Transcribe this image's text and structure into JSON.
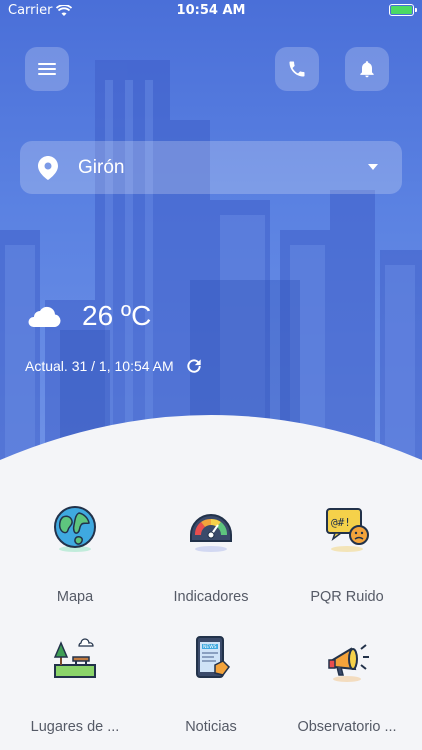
{
  "status_bar": {
    "carrier": "Carrier",
    "time": "10:54 AM"
  },
  "header": {
    "location": "Girón",
    "temperature": "26 ºC",
    "updated": "Actual. 31 / 1, 10:54 AM"
  },
  "menu": [
    {
      "label": "Mapa",
      "icon": "globe-icon"
    },
    {
      "label": "Indicadores",
      "icon": "gauge-icon"
    },
    {
      "label": "PQR Ruido",
      "icon": "noise-complaint-icon"
    },
    {
      "label": "Lugares de ...",
      "icon": "park-icon"
    },
    {
      "label": "Noticias",
      "icon": "news-icon"
    },
    {
      "label": "Observatorio ...",
      "icon": "megaphone-icon"
    }
  ],
  "colors": {
    "accent": "#4a6fd8",
    "background": "#f4f5f8",
    "label": "#555a66"
  }
}
